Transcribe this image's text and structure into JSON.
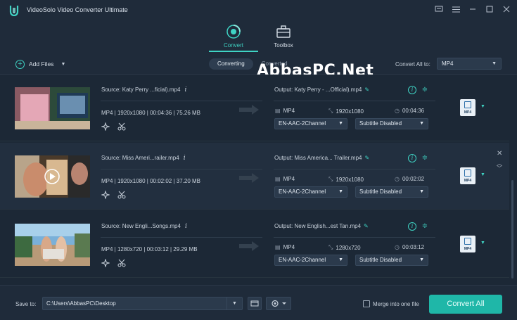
{
  "app": {
    "title": "VideoSolo Video Converter Ultimate"
  },
  "nav": {
    "tabs": [
      {
        "label": "Convert",
        "active": true
      },
      {
        "label": "Toolbox",
        "active": false
      }
    ]
  },
  "toolbar": {
    "add_files": "Add Files",
    "segments": [
      {
        "label": "Converting",
        "active": true
      },
      {
        "label": "Converted",
        "active": false
      }
    ],
    "convert_all_to_label": "Convert All to:",
    "convert_all_format": "MP4"
  },
  "watermark": "AbbasPC.Net",
  "rows": [
    {
      "source": "Source: Katy Perry ...ficial).mp4",
      "meta": "MP4 | 1920x1080 | 00:04:36 | 75.26 MB",
      "output": "Output: Katy Perry - ...Official).mp4",
      "out_format": "MP4",
      "out_resolution": "1920x1080",
      "out_duration": "00:04:36",
      "audio": "EN-AAC-2Channel",
      "subtitle": "Subtitle Disabled",
      "format_badge": "MP4"
    },
    {
      "source": "Source: Miss Ameri...railer.mp4",
      "meta": "MP4 | 1920x1080 | 00:02:02 | 37.20 MB",
      "output": "Output: Miss America... Trailer.mp4",
      "out_format": "MP4",
      "out_resolution": "1920x1080",
      "out_duration": "00:02:02",
      "audio": "EN-AAC-2Channel",
      "subtitle": "Subtitle Disabled",
      "format_badge": "MP4"
    },
    {
      "source": "Source: New Engli...Songs.mp4",
      "meta": "MP4 | 1280x720 | 00:03:12 | 29.29 MB",
      "output": "Output: New English...est Tan.mp4",
      "out_format": "MP4",
      "out_resolution": "1280x720",
      "out_duration": "00:03:12",
      "audio": "EN-AAC-2Channel",
      "subtitle": "Subtitle Disabled",
      "format_badge": "MP4"
    }
  ],
  "footer": {
    "save_to_label": "Save to:",
    "save_path": "C:\\Users\\AbbasPC\\Desktop",
    "merge_label": "Merge into one file",
    "convert_all_button": "Convert All"
  },
  "colors": {
    "accent": "#3fd4c4",
    "button": "#1fb7a8",
    "background": "#1c2836"
  }
}
